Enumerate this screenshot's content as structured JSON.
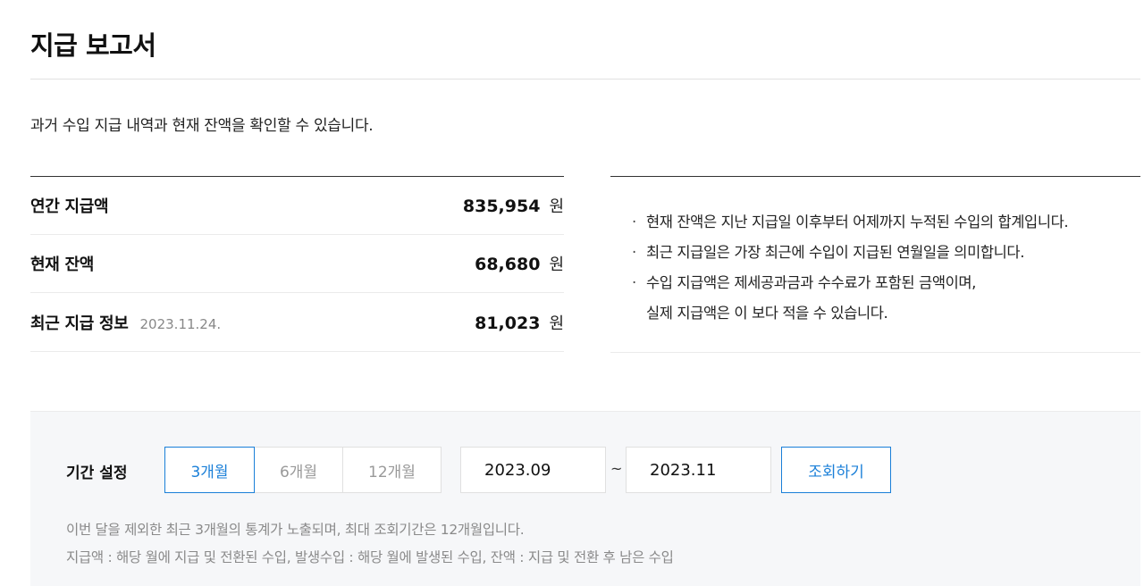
{
  "header": {
    "title": "지급 보고서"
  },
  "description": "과거 수입 지급 내역과 현재 잔액을 확인할 수 있습니다.",
  "summary": {
    "currency_unit": "원",
    "rows": [
      {
        "label": "연간 지급액",
        "amount": "835,954"
      },
      {
        "label": "현재 잔액",
        "amount": "68,680"
      },
      {
        "label": "최근 지급 정보",
        "date": "2023.11.24.",
        "amount": "81,023"
      }
    ]
  },
  "notes": {
    "bullet": "·",
    "items": [
      "현재 잔액은 지난 지급일 이후부터 어제까지 누적된 수입의 합계입니다.",
      "최근 지급일은 가장 최근에 수입이 지급된 연월일을 의미합니다.",
      "수입 지급액은 제세공과금과 수수료가 포함된 금액이며,\n실제 지급액은 이 보다 적을 수 있습니다."
    ]
  },
  "filter": {
    "label": "기간 설정",
    "periods": [
      {
        "label": "3개월",
        "selected": true
      },
      {
        "label": "6개월",
        "selected": false
      },
      {
        "label": "12개월",
        "selected": false
      }
    ],
    "start_date": "2023.09",
    "separator": "~",
    "end_date": "2023.11",
    "search_label": "조회하기",
    "notes": [
      "이번 달을 제외한 최근 3개월의 통계가 노출되며, 최대 조회기간은 12개월입니다.",
      "지급액 : 해당 월에 지급 및 전환된 수입, 발생수입 : 해당 월에 발생된 수입, 잔액 : 지급 및 전환 후 남은 수입"
    ]
  },
  "colors": {
    "accent": "#1a7fd8",
    "muted_text": "#8a8a8a",
    "panel_background": "#f6f7f9"
  }
}
